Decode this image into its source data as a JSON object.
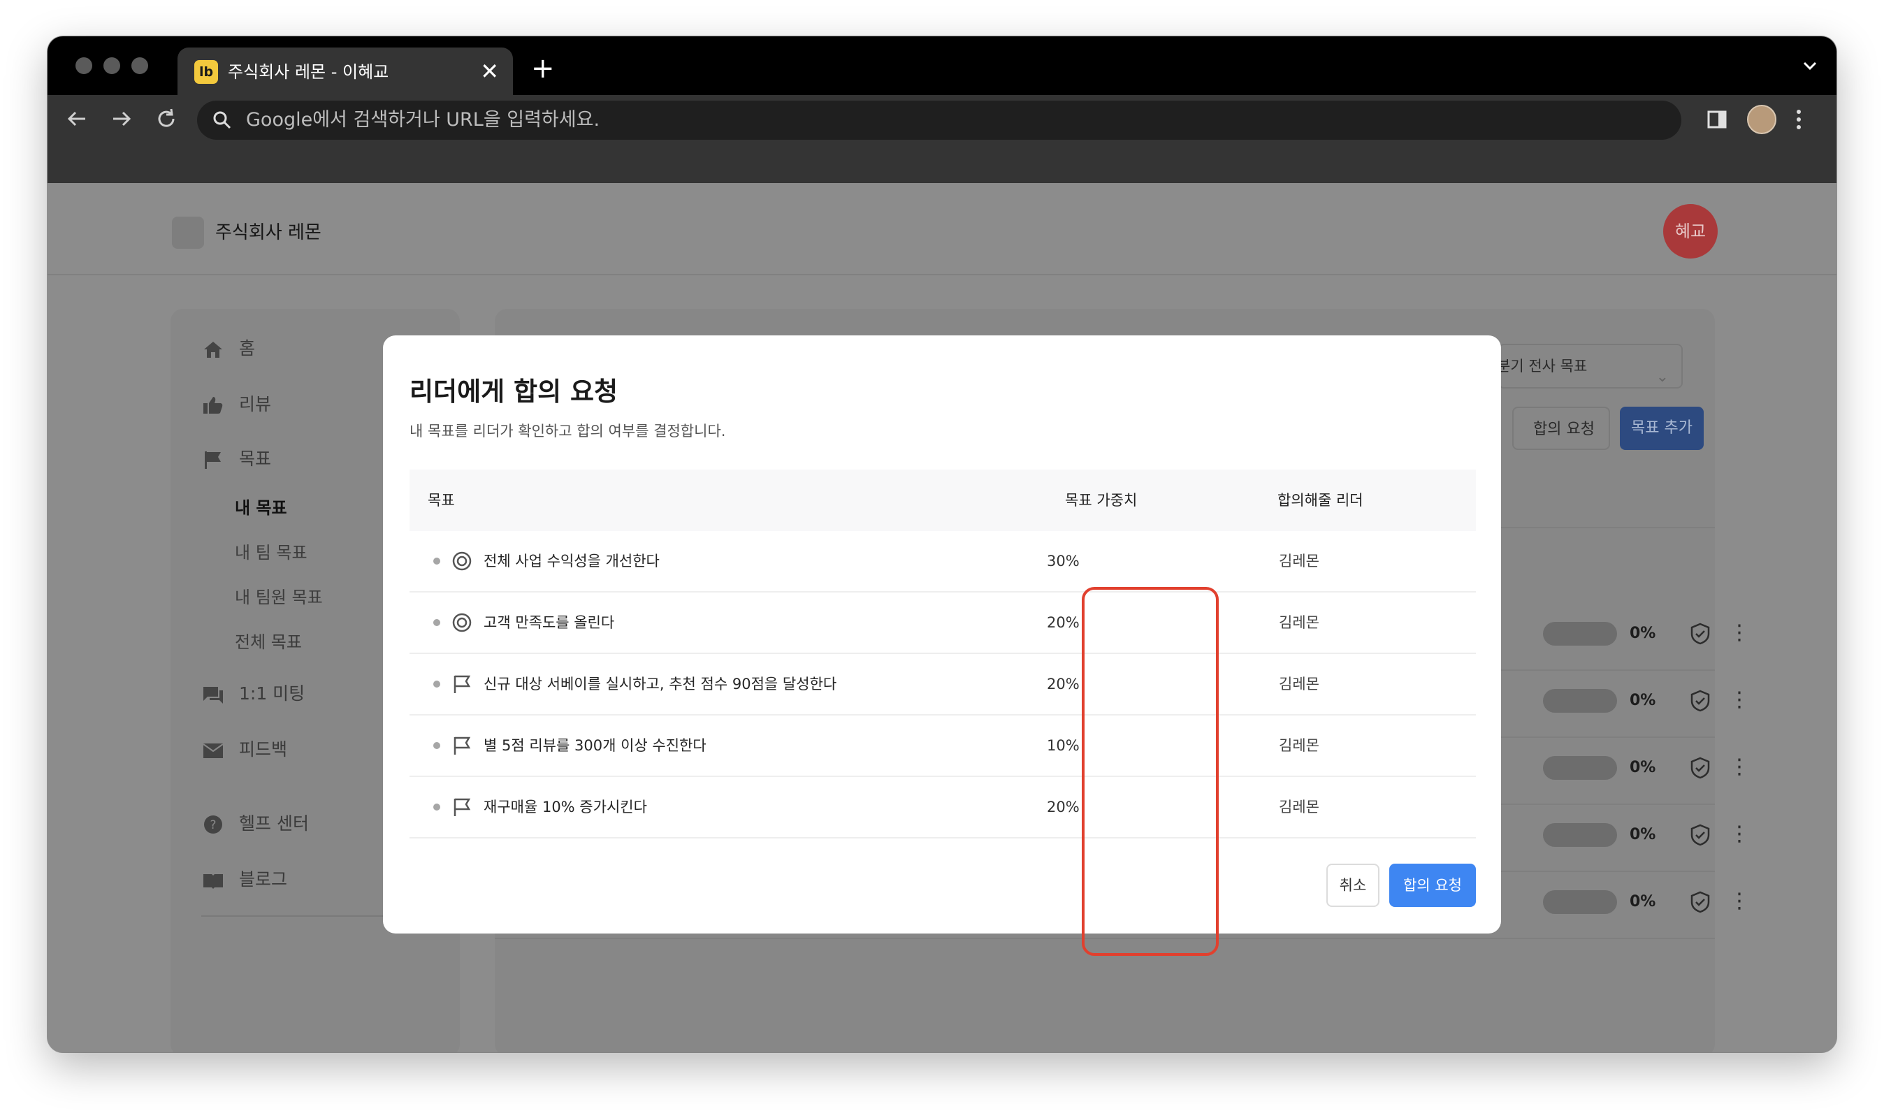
{
  "browser": {
    "tab_title": "주식회사 레몬 - 이혜교",
    "tab_favicon": "lb",
    "omnibox_placeholder": "Google에서 검색하거나 URL을 입력하세요."
  },
  "app": {
    "company_name": "주식회사 레몬",
    "user_avatar": "혜교",
    "sidebar": {
      "items": [
        {
          "label": "홈",
          "icon": "home-icon"
        },
        {
          "label": "리뷰",
          "icon": "thumbs-up-icon"
        },
        {
          "label": "목표",
          "icon": "flag-icon"
        },
        {
          "label": "1:1 미팅",
          "icon": "chat-icon"
        },
        {
          "label": "피드백",
          "icon": "mail-icon"
        },
        {
          "label": "헬프 센터",
          "icon": "help-icon"
        },
        {
          "label": "블로그",
          "icon": "book-icon"
        }
      ],
      "goal_subitems": [
        "내 목표",
        "내 팀 목표",
        "내 팀원 목표",
        "전체 목표"
      ],
      "active_subitem": "내 목표"
    },
    "main": {
      "period_select": "분기 전사 목표",
      "agree_button": "합의 요청",
      "add_button": "목표 추가",
      "progress_values": [
        "0%",
        "0%",
        "0%",
        "0%",
        "0%"
      ]
    }
  },
  "modal": {
    "title": "리더에게 합의 요청",
    "subtitle": "내 목표를 리더가 확인하고 합의 여부를 결정합니다.",
    "columns": [
      "목표",
      "목표 가중치",
      "합의해줄 리더"
    ],
    "rows": [
      {
        "icon": "target-icon",
        "goal": "전체 사업 수익성을 개선한다",
        "weight": "30%",
        "leader": "김레몬"
      },
      {
        "icon": "target-icon",
        "goal": "고객 만족도를 올린다",
        "weight": "20%",
        "leader": "김레몬"
      },
      {
        "icon": "flag-outline-icon",
        "goal": "신규 대상 서베이를 실시하고, 추천 점수 90점을 달성한다",
        "weight": "20%",
        "leader": "김레몬"
      },
      {
        "icon": "flag-outline-icon",
        "goal": "별 5점 리뷰를 300개 이상 수진한다",
        "weight": "10%",
        "leader": "김레몬"
      },
      {
        "icon": "flag-outline-icon",
        "goal": "재구매율 10% 증가시킨다",
        "weight": "20%",
        "leader": "김레몬"
      }
    ],
    "cancel_label": "취소",
    "request_label": "합의 요청",
    "highlight_color": "#e1402e",
    "primary_color": "#3e86f2"
  }
}
